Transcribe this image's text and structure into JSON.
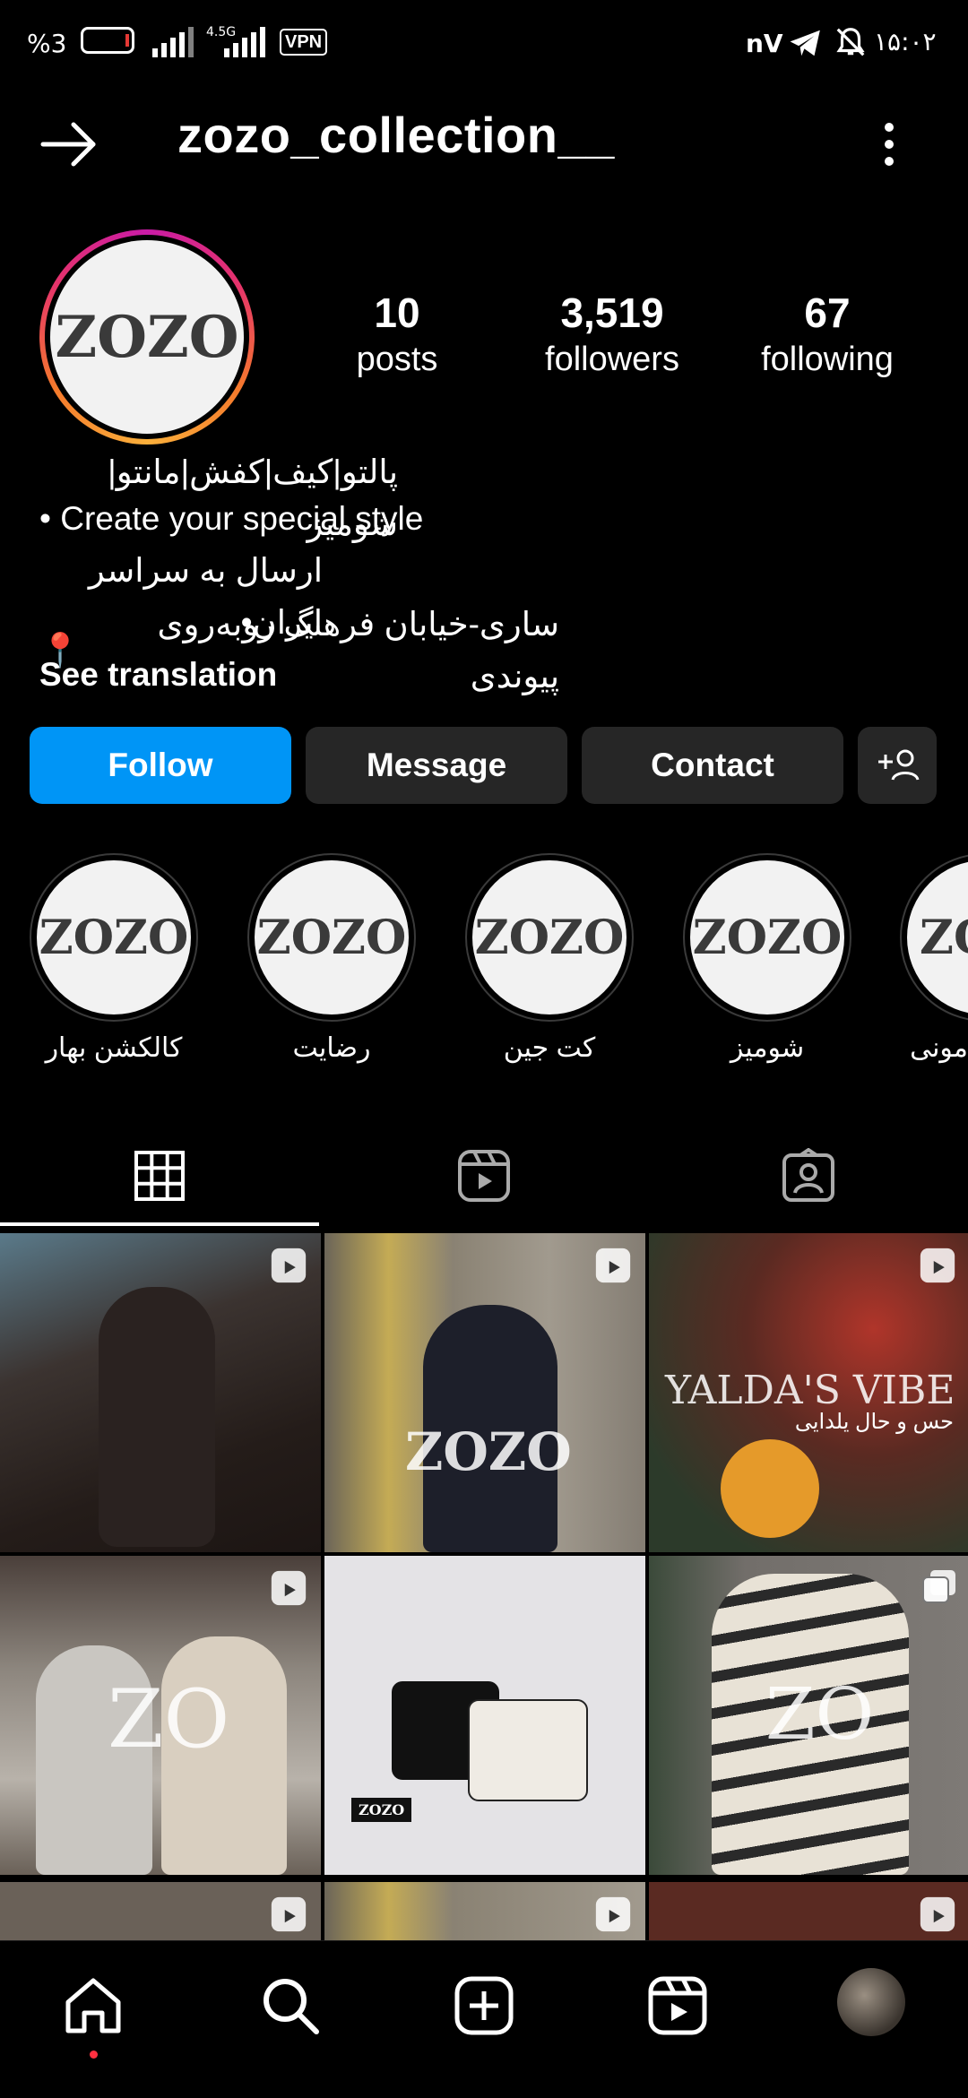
{
  "status_bar": {
    "battery_text": "%3",
    "network": "4.5G",
    "vpn": "VPN",
    "carrier_badge": "nV",
    "time": "۱۵:۰۲"
  },
  "header": {
    "username": "zozo_collection__",
    "back_icon": "arrow-icon",
    "menu_icon": "more-vertical-icon"
  },
  "profile": {
    "avatar_text": "ZOZO",
    "stats": [
      {
        "value": "10",
        "label": "posts"
      },
      {
        "value": "3,519",
        "label": "followers"
      },
      {
        "value": "67",
        "label": "following"
      }
    ]
  },
  "bio": {
    "line1": "پالتو|کیف|کفش|مانتو|شومیز",
    "line2": "• Create your special style",
    "line3": "ارسال به سراسر ایران•",
    "line4": "ساری-خیابان فرهنگ روبه‌روی پیوندی",
    "line4_icon": "📍",
    "see_translation": "See translation"
  },
  "actions": {
    "follow": "Follow",
    "message": "Message",
    "contact": "Contact",
    "add_user_icon": "add-person-icon"
  },
  "highlights": [
    {
      "cover": "ZOZO",
      "label": "کالکشن بهار"
    },
    {
      "cover": "ZOZO",
      "label": "رضایت"
    },
    {
      "cover": "ZOZO",
      "label": "کت جین"
    },
    {
      "cover": "ZOZO",
      "label": "شومیز"
    },
    {
      "cover": "ZO",
      "label": "مونی"
    }
  ],
  "tabs": [
    "grid-icon",
    "reels-icon",
    "tagged-icon"
  ],
  "posts": [
    {
      "overlay": "",
      "badge": "reel-icon"
    },
    {
      "overlay": "ZOZO",
      "badge": "reel-icon"
    },
    {
      "overlay": "YALDA'S VIBE",
      "overlay2": "حس و حال یلدایی",
      "badge": "reel-icon"
    },
    {
      "overlay": "ZO",
      "badge": "reel-icon"
    },
    {
      "overlay": "ZOZO",
      "badge": ""
    },
    {
      "overlay": "ZO",
      "badge": "carousel-icon"
    }
  ],
  "bottom_nav": [
    "home-icon",
    "search-icon",
    "create-icon",
    "reels-icon",
    "profile-avatar"
  ],
  "colors": {
    "follow_blue": "#0095f6",
    "button_gray": "#262626",
    "background": "#000000"
  }
}
